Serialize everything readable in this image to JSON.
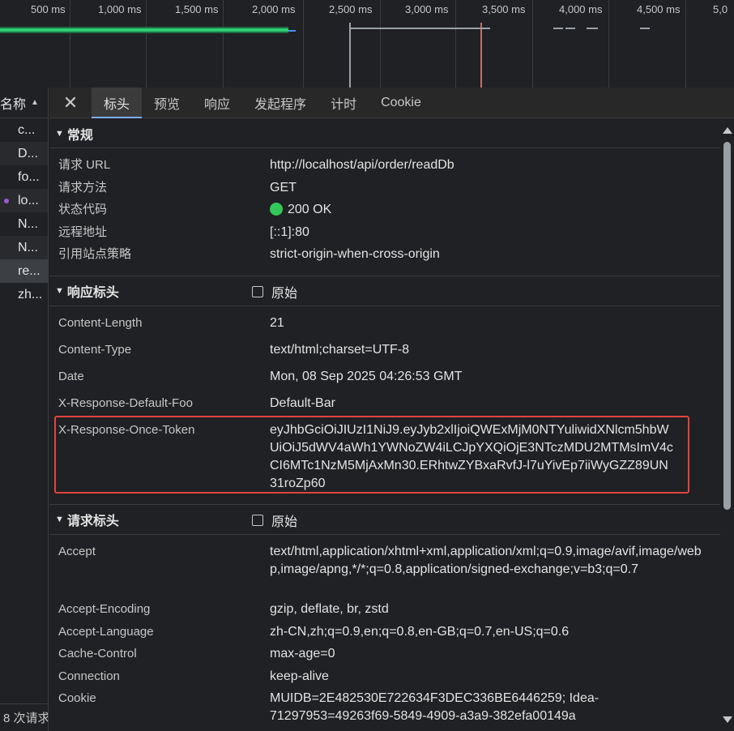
{
  "timeline": {
    "ticks": [
      "500 ms",
      "1,000 ms",
      "1,500 ms",
      "2,000 ms",
      "2,500 ms",
      "3,000 ms",
      "3,500 ms",
      "4,000 ms",
      "4,500 ms",
      "5,0"
    ]
  },
  "network_list": {
    "header": "名称",
    "sort_icon": "sort-ascending-icon",
    "items": [
      "c...",
      "D...",
      "fo...",
      "lo...",
      "N...",
      "N...",
      "re...",
      "zh..."
    ],
    "status_text": "8 次请求"
  },
  "tabs": [
    "标头",
    "预览",
    "响应",
    "发起程序",
    "计时",
    "Cookie"
  ],
  "active_tab": "标头",
  "general": {
    "title": "常规",
    "rows": [
      {
        "key": "请求 URL",
        "value": "http://localhost/api/order/readDb"
      },
      {
        "key": "请求方法",
        "value": "GET"
      },
      {
        "key": "状态代码",
        "value": "200 OK"
      },
      {
        "key": "远程地址",
        "value": "[::1]:80"
      },
      {
        "key": "引用站点策略",
        "value": "strict-origin-when-cross-origin"
      }
    ]
  },
  "response_headers": {
    "title": "响应标头",
    "raw_label": "原始",
    "rows": [
      {
        "key": "Content-Length",
        "value": "21"
      },
      {
        "key": "Content-Type",
        "value": "text/html;charset=UTF-8"
      },
      {
        "key": "Date",
        "value": "Mon, 08 Sep 2025 04:26:53 GMT"
      },
      {
        "key": "X-Response-Default-Foo",
        "value": "Default-Bar"
      },
      {
        "key": "X-Response-Once-Token",
        "value": "eyJhbGciOiJIUzI1NiJ9.eyJyb2xlIjoiQWExMjM0NTYuliwidXNlcm5hbWUiOiJ5dWV4aWh1YWNoZW4iLCJpYXQiOjE3NTczMDU2MTMsImV4cCI6MTc1NzM5MjAxMn30.ERhtwZYBxaRvfJ-l7uYivEp7iiWyGZZ89UN31roZp60"
      }
    ]
  },
  "request_headers": {
    "title": "请求标头",
    "raw_label": "原始",
    "rows": [
      {
        "key": "Accept",
        "value": "text/html,application/xhtml+xml,application/xml;q=0.9,image/avif,image/webp,image/apng,*/*;q=0.8,application/signed-exchange;v=b3;q=0.7"
      },
      {
        "key": "Accept-Encoding",
        "value": "gzip, deflate, br, zstd"
      },
      {
        "key": "Accept-Language",
        "value": "zh-CN,zh;q=0.9,en;q=0.8,en-GB;q=0.7,en-US;q=0.6"
      },
      {
        "key": "Cache-Control",
        "value": "max-age=0"
      },
      {
        "key": "Connection",
        "value": "keep-alive"
      },
      {
        "key": "Cookie",
        "value": "MUIDB=2E482530E722634F3DEC336BE6446259; Idea-71297953=49263f69-5849-4909-a3a9-382efa00149a"
      }
    ]
  },
  "colors": {
    "accent": "#7cacf8",
    "status_ok": "#34c759",
    "highlight_border": "#e0443e",
    "timeline_bar": "#2ecc71"
  }
}
